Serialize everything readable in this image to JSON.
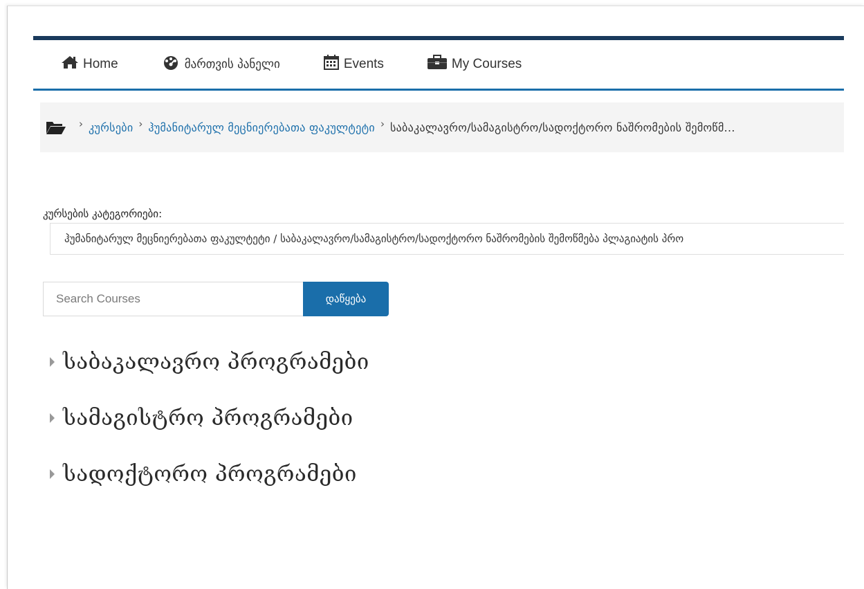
{
  "nav": {
    "items": [
      {
        "label": "Home",
        "icon": "home-icon"
      },
      {
        "label": "მართვის პანელი",
        "icon": "dashboard-icon"
      },
      {
        "label": "Events",
        "icon": "calendar-icon"
      },
      {
        "label": "My Courses",
        "icon": "briefcase-icon"
      }
    ]
  },
  "breadcrumb": {
    "icon": "folder-open-icon",
    "items": [
      "კურსები",
      "ჰუმანიტარულ მეცნიერებათა ფაკულტეტი",
      "საბაკალავრო/სამაგისტრო/სადოქტორო ნაშრომების შემოწმ..."
    ]
  },
  "categories": {
    "label": "კურსების კატეგორიები:",
    "selected": "ჰუმანიტარულ მეცნიერებათა ფაკულტეტი / საბაკალავრო/სამაგისტრო/სადოქტორო ნაშრომების შემოწმება პლაგიატის პრო"
  },
  "search": {
    "placeholder": "Search Courses",
    "button_label": "დაწყება"
  },
  "programs": [
    "საბაკალავრო პროგრამები",
    "სამაგისტრო პროგრამები",
    "სადოქტორო პროგრამები"
  ],
  "colors": {
    "accent": "#1a6eaa",
    "topbar": "#1a3a5c"
  }
}
